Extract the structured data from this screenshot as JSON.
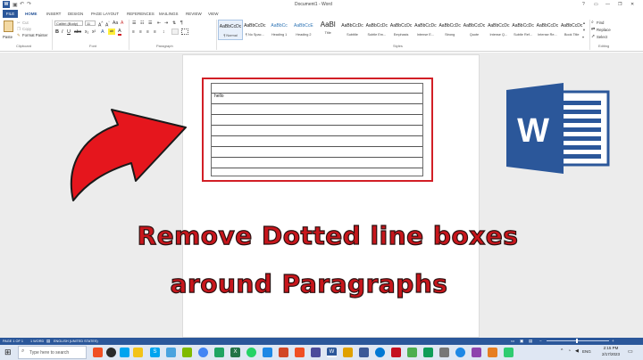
{
  "window": {
    "title": "Document1 - Word",
    "help": "?",
    "minimize": "—",
    "restore": "❐",
    "close": "✕"
  },
  "ribbon_tabs": [
    "HOME",
    "INSERT",
    "DESIGN",
    "PAGE LAYOUT",
    "REFERENCES",
    "MAILINGS",
    "REVIEW",
    "VIEW"
  ],
  "file_tab": "FILE",
  "clipboard": {
    "paste": "Paste",
    "cut": "Cut",
    "copy": "Copy",
    "format_painter": "Format Painter",
    "label": "Clipboard"
  },
  "font": {
    "name": "Calibri (Body)",
    "size": "11",
    "label": "Font"
  },
  "paragraph": {
    "label": "Paragraph"
  },
  "styles": {
    "label": "Styles",
    "items": [
      {
        "preview": "AaBbCcDc",
        "name": "¶ Normal"
      },
      {
        "preview": "AaBbCcDc",
        "name": "¶ No Spac..."
      },
      {
        "preview": "AaBbCc",
        "name": "Heading 1"
      },
      {
        "preview": "AaBbCcE",
        "name": "Heading 2"
      },
      {
        "preview": "AaBl",
        "name": "Title"
      },
      {
        "preview": "AaBbCcDc",
        "name": "Subtitle"
      },
      {
        "preview": "AaBbCcDc",
        "name": "Subtle Em..."
      },
      {
        "preview": "AaBbCcDc",
        "name": "Emphasis"
      },
      {
        "preview": "AaBbCcDc",
        "name": "Intense E..."
      },
      {
        "preview": "AaBbCcDc",
        "name": "Strong"
      },
      {
        "preview": "AaBbCcDc",
        "name": "Quote"
      },
      {
        "preview": "AaBbCcDc",
        "name": "Intense Q..."
      },
      {
        "preview": "AaBbCcDc",
        "name": "Subtle Ref..."
      },
      {
        "preview": "AaBbCcDc",
        "name": "Intense Re..."
      },
      {
        "preview": "AaBbCcDc",
        "name": "Book Title"
      }
    ]
  },
  "editing": {
    "find": "Find",
    "replace": "Replace",
    "select": "Select",
    "label": "Editing"
  },
  "document": {
    "text": "hello"
  },
  "caption": {
    "line1": "Remove Dotted line boxes",
    "line2": "around  Paragraphs"
  },
  "status": {
    "page": "PAGE 1 OF 1",
    "words": "1 WORD",
    "language": "ENGLISH (UNITED STATES)"
  },
  "taskbar": {
    "search_placeholder": "Type here to search",
    "time": "2:15 PM",
    "date": "2/17/2023",
    "lang": "ENG"
  },
  "colors": {
    "word_blue": "#2b579a",
    "caption_red": "#c8161c",
    "arrow_red": "#e5161d",
    "box_red": "#d21f26"
  }
}
